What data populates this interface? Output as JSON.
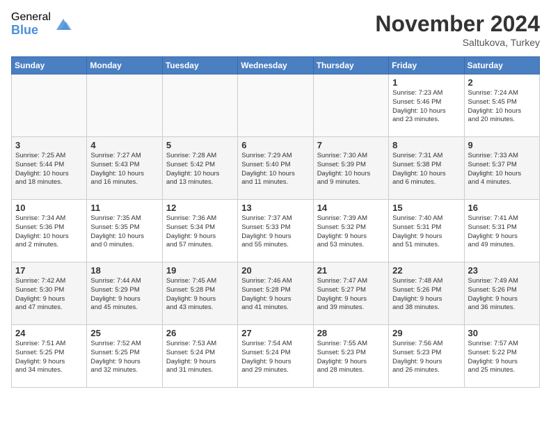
{
  "header": {
    "logo_general": "General",
    "logo_blue": "Blue",
    "month_title": "November 2024",
    "location": "Saltukova, Turkey"
  },
  "weekdays": [
    "Sunday",
    "Monday",
    "Tuesday",
    "Wednesday",
    "Thursday",
    "Friday",
    "Saturday"
  ],
  "weeks": [
    [
      {
        "day": "",
        "info": ""
      },
      {
        "day": "",
        "info": ""
      },
      {
        "day": "",
        "info": ""
      },
      {
        "day": "",
        "info": ""
      },
      {
        "day": "",
        "info": ""
      },
      {
        "day": "1",
        "info": "Sunrise: 7:23 AM\nSunset: 5:46 PM\nDaylight: 10 hours\nand 23 minutes."
      },
      {
        "day": "2",
        "info": "Sunrise: 7:24 AM\nSunset: 5:45 PM\nDaylight: 10 hours\nand 20 minutes."
      }
    ],
    [
      {
        "day": "3",
        "info": "Sunrise: 7:25 AM\nSunset: 5:44 PM\nDaylight: 10 hours\nand 18 minutes."
      },
      {
        "day": "4",
        "info": "Sunrise: 7:27 AM\nSunset: 5:43 PM\nDaylight: 10 hours\nand 16 minutes."
      },
      {
        "day": "5",
        "info": "Sunrise: 7:28 AM\nSunset: 5:42 PM\nDaylight: 10 hours\nand 13 minutes."
      },
      {
        "day": "6",
        "info": "Sunrise: 7:29 AM\nSunset: 5:40 PM\nDaylight: 10 hours\nand 11 minutes."
      },
      {
        "day": "7",
        "info": "Sunrise: 7:30 AM\nSunset: 5:39 PM\nDaylight: 10 hours\nand 9 minutes."
      },
      {
        "day": "8",
        "info": "Sunrise: 7:31 AM\nSunset: 5:38 PM\nDaylight: 10 hours\nand 6 minutes."
      },
      {
        "day": "9",
        "info": "Sunrise: 7:33 AM\nSunset: 5:37 PM\nDaylight: 10 hours\nand 4 minutes."
      }
    ],
    [
      {
        "day": "10",
        "info": "Sunrise: 7:34 AM\nSunset: 5:36 PM\nDaylight: 10 hours\nand 2 minutes."
      },
      {
        "day": "11",
        "info": "Sunrise: 7:35 AM\nSunset: 5:35 PM\nDaylight: 10 hours\nand 0 minutes."
      },
      {
        "day": "12",
        "info": "Sunrise: 7:36 AM\nSunset: 5:34 PM\nDaylight: 9 hours\nand 57 minutes."
      },
      {
        "day": "13",
        "info": "Sunrise: 7:37 AM\nSunset: 5:33 PM\nDaylight: 9 hours\nand 55 minutes."
      },
      {
        "day": "14",
        "info": "Sunrise: 7:39 AM\nSunset: 5:32 PM\nDaylight: 9 hours\nand 53 minutes."
      },
      {
        "day": "15",
        "info": "Sunrise: 7:40 AM\nSunset: 5:31 PM\nDaylight: 9 hours\nand 51 minutes."
      },
      {
        "day": "16",
        "info": "Sunrise: 7:41 AM\nSunset: 5:31 PM\nDaylight: 9 hours\nand 49 minutes."
      }
    ],
    [
      {
        "day": "17",
        "info": "Sunrise: 7:42 AM\nSunset: 5:30 PM\nDaylight: 9 hours\nand 47 minutes."
      },
      {
        "day": "18",
        "info": "Sunrise: 7:44 AM\nSunset: 5:29 PM\nDaylight: 9 hours\nand 45 minutes."
      },
      {
        "day": "19",
        "info": "Sunrise: 7:45 AM\nSunset: 5:28 PM\nDaylight: 9 hours\nand 43 minutes."
      },
      {
        "day": "20",
        "info": "Sunrise: 7:46 AM\nSunset: 5:28 PM\nDaylight: 9 hours\nand 41 minutes."
      },
      {
        "day": "21",
        "info": "Sunrise: 7:47 AM\nSunset: 5:27 PM\nDaylight: 9 hours\nand 39 minutes."
      },
      {
        "day": "22",
        "info": "Sunrise: 7:48 AM\nSunset: 5:26 PM\nDaylight: 9 hours\nand 38 minutes."
      },
      {
        "day": "23",
        "info": "Sunrise: 7:49 AM\nSunset: 5:26 PM\nDaylight: 9 hours\nand 36 minutes."
      }
    ],
    [
      {
        "day": "24",
        "info": "Sunrise: 7:51 AM\nSunset: 5:25 PM\nDaylight: 9 hours\nand 34 minutes."
      },
      {
        "day": "25",
        "info": "Sunrise: 7:52 AM\nSunset: 5:25 PM\nDaylight: 9 hours\nand 32 minutes."
      },
      {
        "day": "26",
        "info": "Sunrise: 7:53 AM\nSunset: 5:24 PM\nDaylight: 9 hours\nand 31 minutes."
      },
      {
        "day": "27",
        "info": "Sunrise: 7:54 AM\nSunset: 5:24 PM\nDaylight: 9 hours\nand 29 minutes."
      },
      {
        "day": "28",
        "info": "Sunrise: 7:55 AM\nSunset: 5:23 PM\nDaylight: 9 hours\nand 28 minutes."
      },
      {
        "day": "29",
        "info": "Sunrise: 7:56 AM\nSunset: 5:23 PM\nDaylight: 9 hours\nand 26 minutes."
      },
      {
        "day": "30",
        "info": "Sunrise: 7:57 AM\nSunset: 5:22 PM\nDaylight: 9 hours\nand 25 minutes."
      }
    ]
  ]
}
